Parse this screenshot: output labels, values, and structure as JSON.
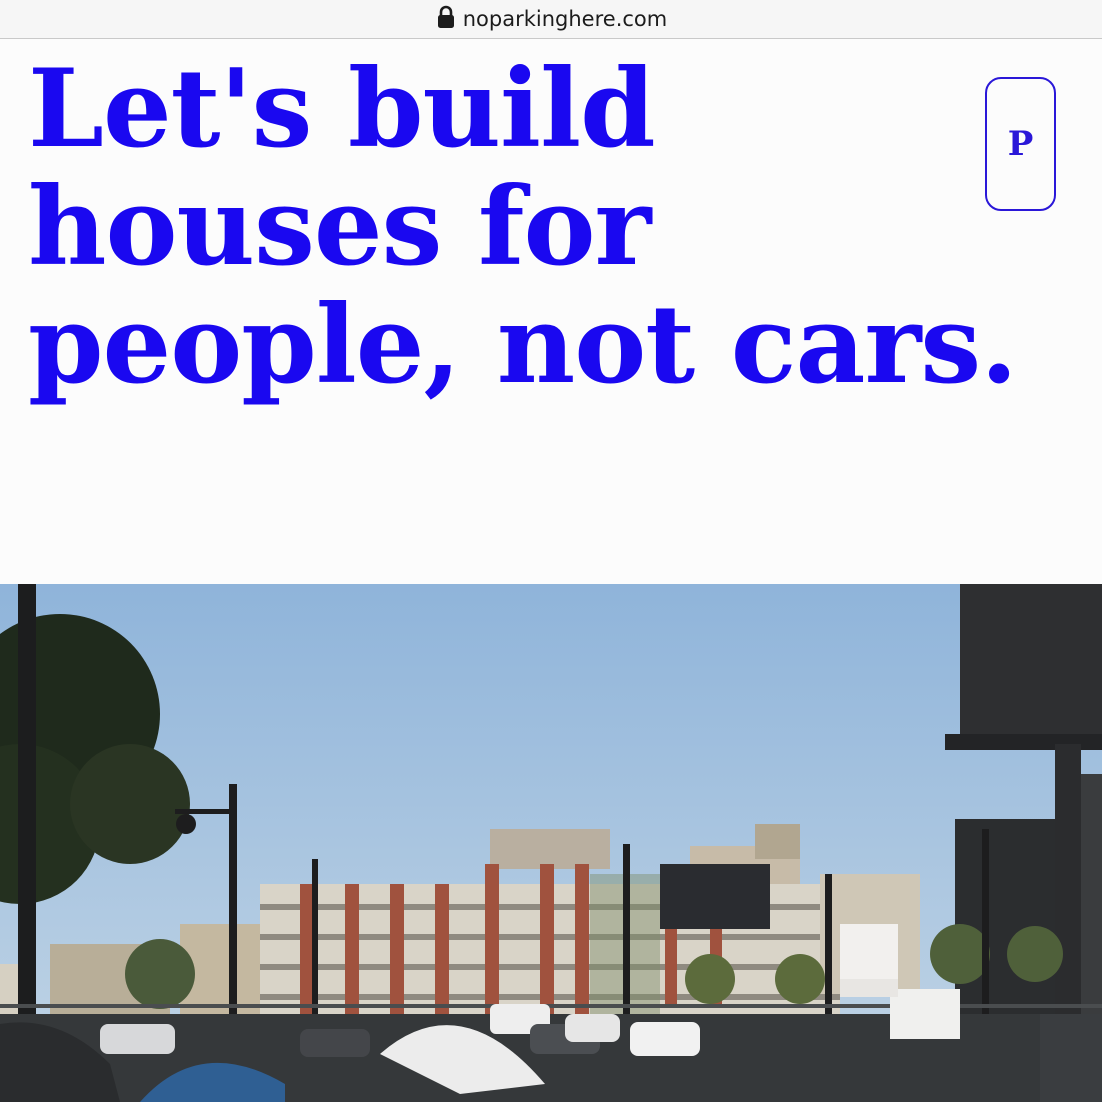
{
  "browser": {
    "url": "noparkinghere.com"
  },
  "hero": {
    "headline_lines": [
      "Let's build",
      "houses for",
      "people, not cars."
    ]
  },
  "logo": {
    "letter": "P"
  },
  "colors": {
    "brand_blue": "#1a08f0",
    "sky": "#a9c7e3"
  },
  "icons": {
    "lock": "lock-icon"
  }
}
